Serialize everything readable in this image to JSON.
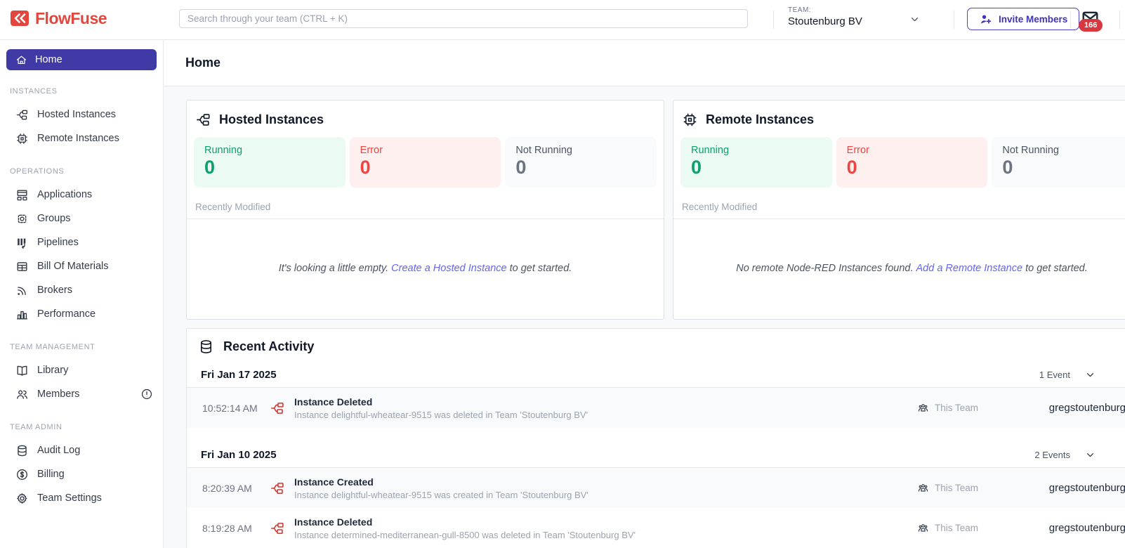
{
  "colors": {
    "brand_red": "#E2463D",
    "active_indigo": "#3F3AA6",
    "accent_indigo": "#4C42C8",
    "link_indigo": "#6366F1",
    "running_green": "#0E9F6E",
    "running_bg": "#EBFAF2",
    "error_red": "#EF4444",
    "error_bg": "#FDF0EF",
    "not_running_gray": "#6B7280",
    "not_running_bg": "#F9FAFB",
    "notification_badge_red": "#D7373F",
    "event_icon_red": "#D0342C"
  },
  "brand": {
    "name": "FlowFuse",
    "logo_icon": "flowfuse-chevrons-icon"
  },
  "header": {
    "search_placeholder": "Search through your team (CTRL + K)",
    "team_label": "TEAM:",
    "team_name": "Stoutenburg BV",
    "invite_button_label": "Invite Members",
    "notification_count": "166",
    "notification_icon": "mail-icon"
  },
  "sidebar": {
    "home_label": "Home",
    "home_icon": "home-icon",
    "sections": [
      {
        "title": "INSTANCES",
        "items": [
          {
            "label": "Hosted Instances",
            "icon": "projects-icon"
          },
          {
            "label": "Remote Instances",
            "icon": "chip-icon"
          }
        ]
      },
      {
        "title": "OPERATIONS",
        "items": [
          {
            "label": "Applications",
            "icon": "applications-icon"
          },
          {
            "label": "Groups",
            "icon": "group-chip-icon"
          },
          {
            "label": "Pipelines",
            "icon": "pipelines-icon"
          },
          {
            "label": "Bill Of Materials",
            "icon": "table-icon"
          },
          {
            "label": "Brokers",
            "icon": "rss-icon"
          },
          {
            "label": "Performance",
            "icon": "bar-chart-icon"
          }
        ]
      },
      {
        "title": "TEAM MANAGEMENT",
        "items": [
          {
            "label": "Library",
            "icon": "book-open-icon"
          },
          {
            "label": "Members",
            "icon": "users-icon",
            "badge_icon": "alert-circle-icon"
          }
        ]
      },
      {
        "title": "TEAM ADMIN",
        "items": [
          {
            "label": "Audit Log",
            "icon": "database-icon"
          },
          {
            "label": "Billing",
            "icon": "dollar-circle-icon"
          },
          {
            "label": "Team Settings",
            "icon": "gear-icon"
          }
        ]
      }
    ]
  },
  "page": {
    "title": "Home"
  },
  "hosted_card": {
    "title": "Hosted Instances",
    "icon": "projects-icon",
    "stats": [
      {
        "label": "Running",
        "value": "0"
      },
      {
        "label": "Error",
        "value": "0"
      },
      {
        "label": "Not Running",
        "value": "0"
      }
    ],
    "recently_modified_label": "Recently Modified",
    "empty_text_before": "It's looking a little empty.",
    "empty_link": "Create a Hosted Instance",
    "empty_text_after": "to get started."
  },
  "remote_card": {
    "title": "Remote Instances",
    "icon": "chip-icon",
    "stats": [
      {
        "label": "Running",
        "value": "0"
      },
      {
        "label": "Error",
        "value": "0"
      },
      {
        "label": "Not Running",
        "value": "0"
      }
    ],
    "recently_modified_label": "Recently Modified",
    "empty_text_before": "No remote Node-RED Instances found.",
    "empty_link": "Add a Remote Instance",
    "empty_text_after": "to get started."
  },
  "activity": {
    "title": "Recent Activity",
    "icon": "database-icon",
    "groups": [
      {
        "date": "Fri Jan 17 2025",
        "count_label": "1 Event",
        "events": [
          {
            "time": "10:52:14 AM",
            "icon": "projects-icon",
            "title": "Instance Deleted",
            "description": "Instance delightful-wheatear-9515 was deleted in Team 'Stoutenburg BV'",
            "scope": "This Team",
            "user": "gregstoutenburg"
          }
        ]
      },
      {
        "date": "Fri Jan 10 2025",
        "count_label": "2 Events",
        "events": [
          {
            "time": "8:20:39 AM",
            "icon": "projects-icon",
            "title": "Instance Created",
            "description": "Instance delightful-wheatear-9515 was created in Team 'Stoutenburg BV'",
            "scope": "This Team",
            "user": "gregstoutenburg"
          },
          {
            "time": "8:19:28 AM",
            "icon": "projects-icon",
            "title": "Instance Deleted",
            "description": "Instance determined-mediterranean-gull-8500 was deleted in Team 'Stoutenburg BV'",
            "scope": "This Team",
            "user": "gregstoutenburg"
          }
        ]
      }
    ]
  }
}
